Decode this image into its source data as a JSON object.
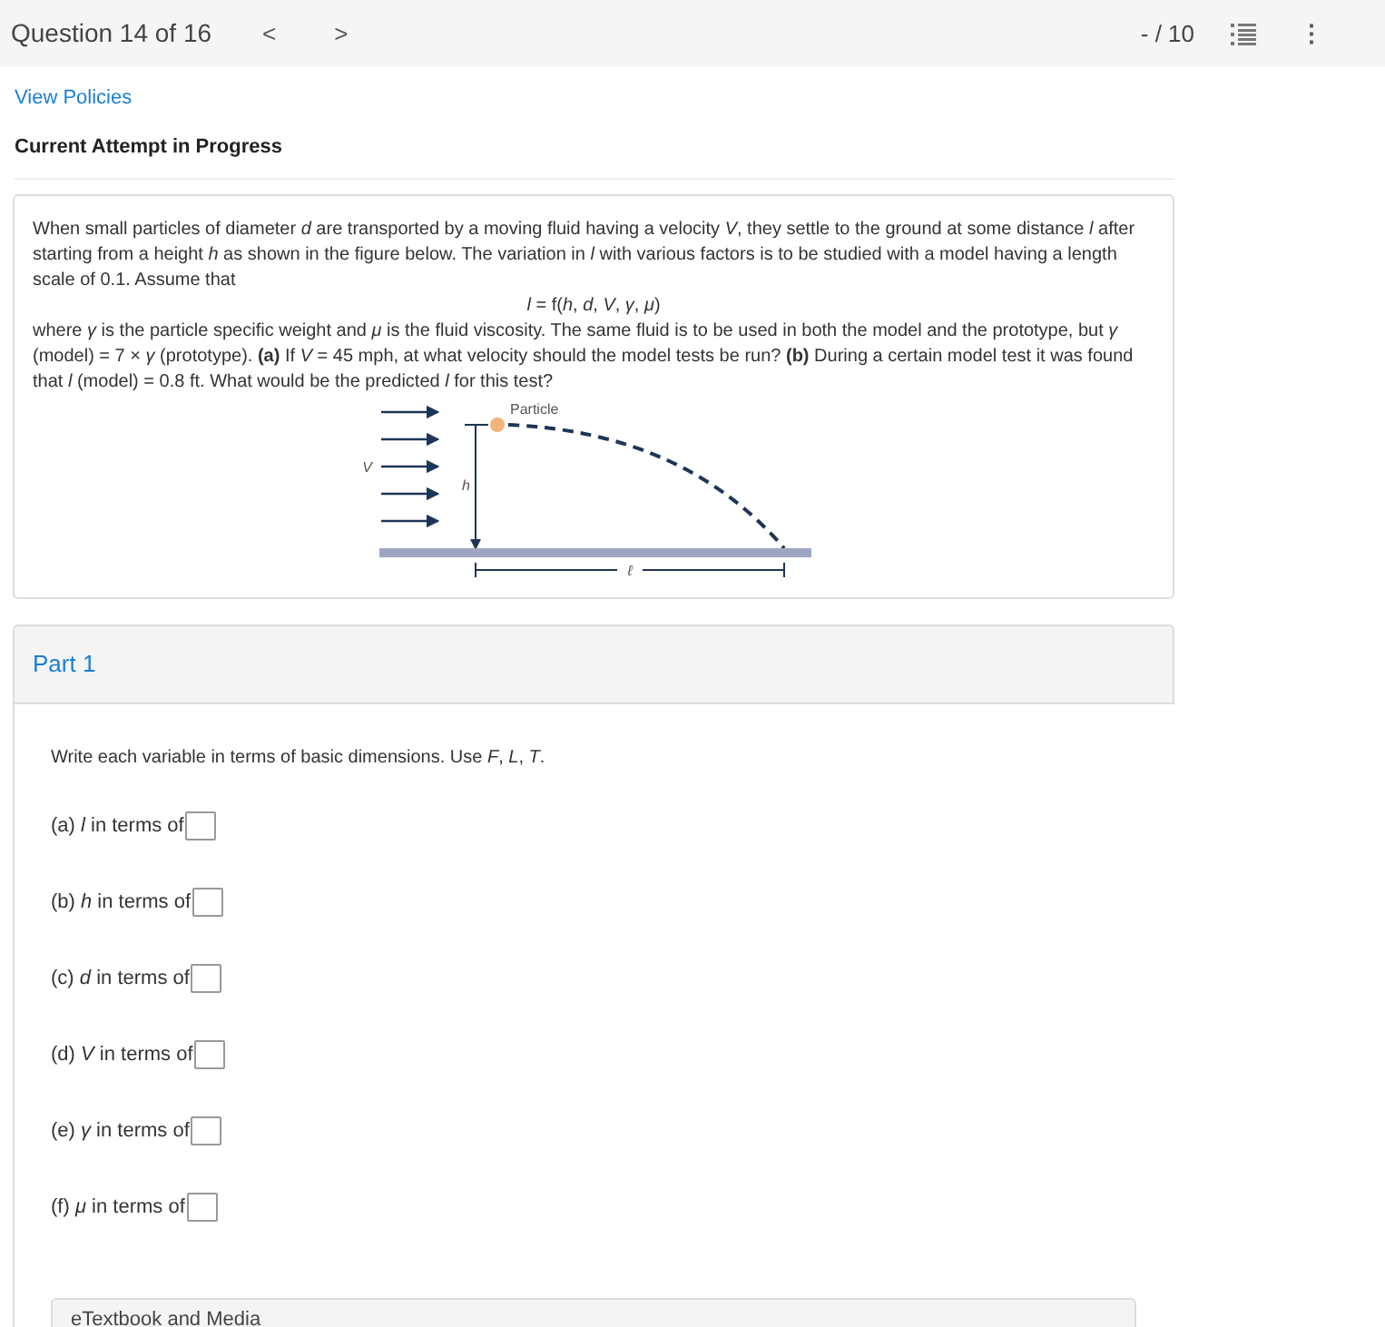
{
  "header": {
    "title": "Question 14 of 16",
    "prev": "<",
    "next": ">",
    "score": "- / 10",
    "menu": "⋮"
  },
  "links": {
    "policies": "View Policies",
    "attempt": "Current Attempt in Progress"
  },
  "question": {
    "paragraphs": [
      "When small particles of diameter *d* are transported by a moving fluid having a velocity *V*, they settle to the ground at some distance *l* after starting from a height *h* as shown in the figure below. The variation in *l* with various factors is to be studied with a model having a length scale of 0.1. Assume that",
      "*l* = f(*h*, *d*, *V*, *γ*, *μ*)",
      "where *γ* is the particle specific weight and *μ* is the fluid viscosity. The same fluid is to be used in both the model and the prototype, but *γ* (model) = 7 × *γ* (prototype). **(a)** If *V* = 45 mph, at what velocity should the model tests be run? **(b)** During a certain model test it was found that *l* (model) = 0.8 ft. What would be the predicted *l* for this test?"
    ],
    "figure": {
      "particle": "Particle",
      "velocity": "V",
      "height": "h",
      "distance": "ℓ"
    }
  },
  "part": {
    "title": "Part 1",
    "instruction": "Write each variable in terms of basic dimensions. Use *F*, *L*, *T*.",
    "items": [
      {
        "label": "(a) *l* in terms of"
      },
      {
        "label": "(b) *h* in terms of"
      },
      {
        "label": "(c) *d* in terms of"
      },
      {
        "label": "(d) *V* in terms of"
      },
      {
        "label": "(e) *γ* in terms of"
      },
      {
        "label": "(f) *μ* in terms of"
      }
    ]
  },
  "resources": {
    "title": "eTextbook and Media"
  }
}
